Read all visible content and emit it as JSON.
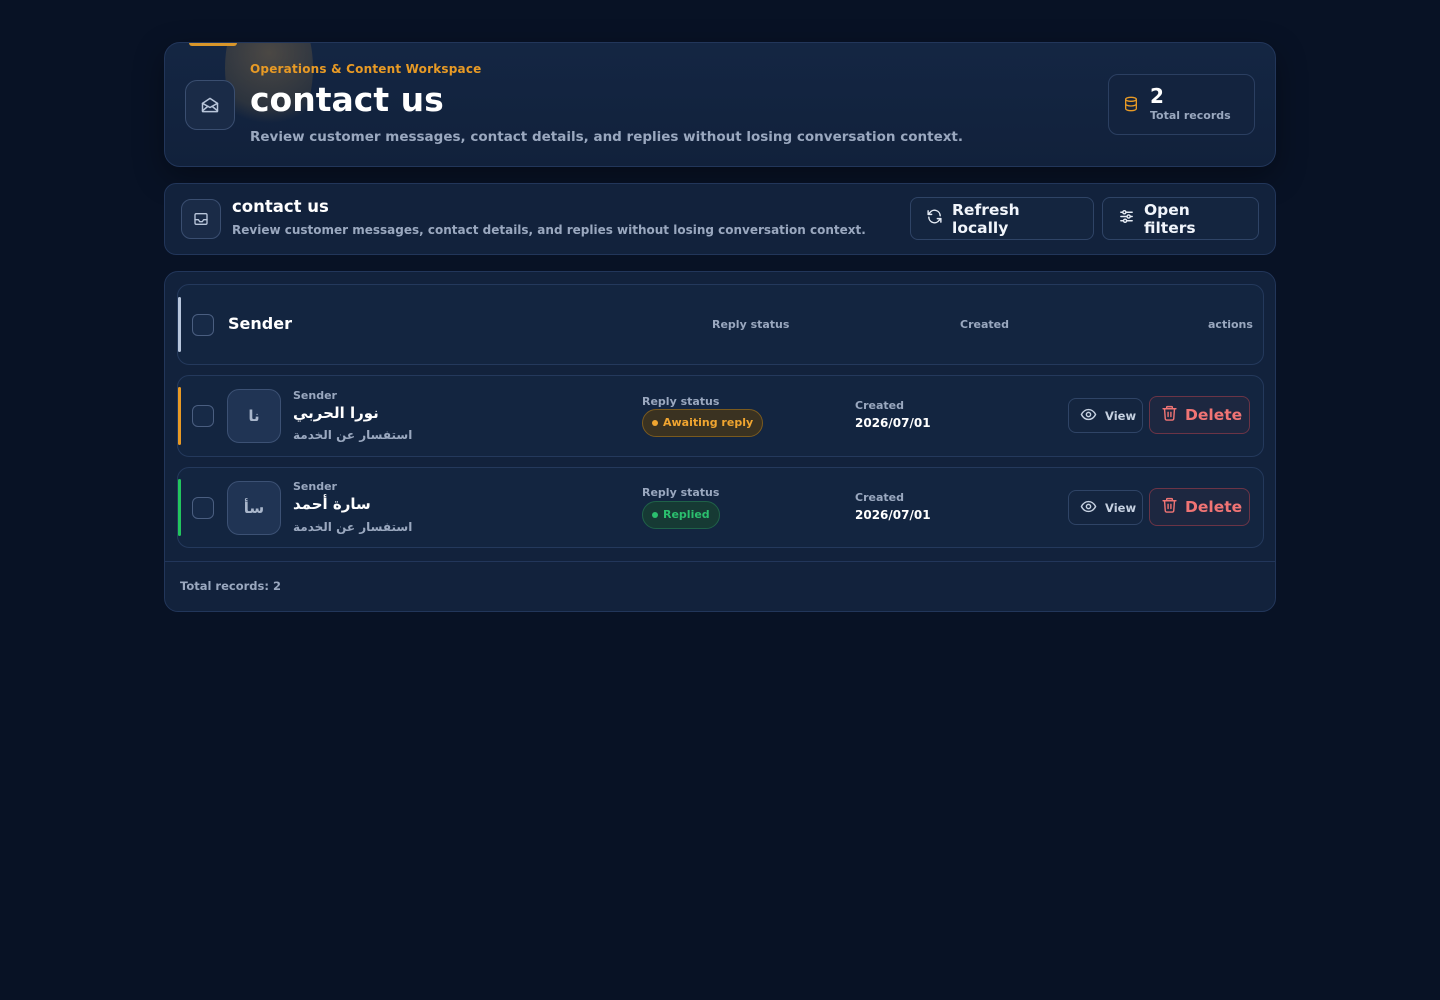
{
  "hero": {
    "eyebrow": "Operations & Content Workspace",
    "title": "contact us",
    "description": "Review customer messages, contact details, and replies without losing conversation context.",
    "stat_value": "2",
    "stat_label": "Total records",
    "icon": "mail-open-icon",
    "stat_icon": "database-icon",
    "accent": "#e89a25"
  },
  "toolbar": {
    "title": "contact us",
    "description": "Review customer messages, contact details, and replies without losing conversation context.",
    "refresh_label": "Refresh locally",
    "filters_label": "Open filters",
    "icon": "inbox-icon"
  },
  "table": {
    "headers": {
      "sender": "Sender",
      "reply_status": "Reply status",
      "created": "Created",
      "actions": "actions"
    },
    "rows": [
      {
        "sender_label": "Sender",
        "initials": "نا",
        "name": "نورا الحربي",
        "subject": "استفسار عن الخدمة",
        "status_label": "Reply status",
        "status": "Awaiting reply",
        "status_color": "#f0a530",
        "created_label": "Created",
        "created": "2026/07/01",
        "view_label": "View",
        "delete_label": "Delete",
        "accent": "#e89a25"
      },
      {
        "sender_label": "Sender",
        "initials": "سأ",
        "name": "سارة أحمد",
        "subject": "استفسار عن الخدمة",
        "status_label": "Reply status",
        "status": "Replied",
        "status_color": "#2bbf6e",
        "created_label": "Created",
        "created": "2026/07/01",
        "view_label": "View",
        "delete_label": "Delete",
        "accent": "#22c55e"
      }
    ],
    "footer": "Total records: 2"
  }
}
